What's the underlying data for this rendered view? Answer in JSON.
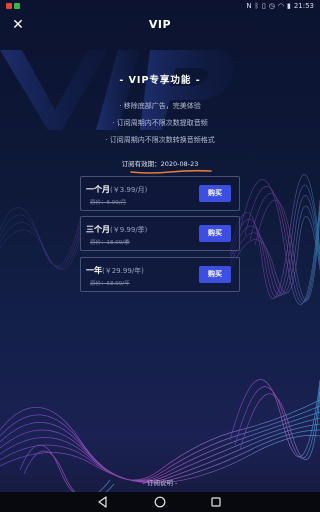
{
  "status_bar": {
    "left_icons": [
      "app-icon",
      "app-icon"
    ],
    "right_icons": [
      "nfc-icon",
      "bluetooth-icon",
      "vibrate-icon",
      "alarm-icon",
      "wifi-icon",
      "battery-icon"
    ],
    "time": "21:53"
  },
  "header": {
    "title": "VIP",
    "close_icon": "close-icon"
  },
  "vip": {
    "heading": "- VIP专享功能 -",
    "features": [
      "· 移除底部广告，完美体验",
      "· 订阅周期内不限次数提取音频",
      "· 订阅周期内不限次数转换音频格式"
    ],
    "expiry": "订阅有效期：2020-08-23",
    "annotation_color": "#e57c3a"
  },
  "plans": [
    {
      "name": "一个月",
      "price": "(￥3.99/月)",
      "original": "原价：6.99/月",
      "buy": "购买"
    },
    {
      "name": "三个月",
      "price": "(￥9.99/季)",
      "original": "原价：18.99/季",
      "buy": "购买"
    },
    {
      "name": "一年",
      "price": "(￥29.99/年)",
      "original": "原价：58.99/年",
      "buy": "购买"
    }
  ],
  "footer": {
    "link": "- 订阅说明 -"
  },
  "nav": {
    "icons": [
      "back-icon",
      "home-icon",
      "recents-icon"
    ]
  },
  "colors": {
    "accent": "#3d4fe0",
    "background": "#0e1838"
  }
}
